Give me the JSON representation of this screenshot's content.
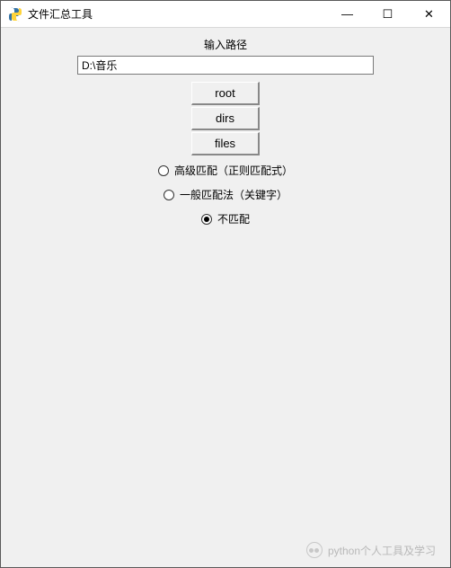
{
  "window": {
    "title": "文件汇总工具",
    "minimize_icon": "—",
    "maximize_icon": "☐",
    "close_icon": "✕"
  },
  "form": {
    "path_label": "输入路径",
    "path_value": "D:\\音乐"
  },
  "buttons": {
    "root": "root",
    "dirs": "dirs",
    "files": "files"
  },
  "radios": {
    "advanced": "高级匹配（正则匹配式）",
    "normal": "一般匹配法（关键字）",
    "none": "不匹配",
    "selected": "none"
  },
  "watermark": {
    "text": "python个人工具及学习"
  }
}
